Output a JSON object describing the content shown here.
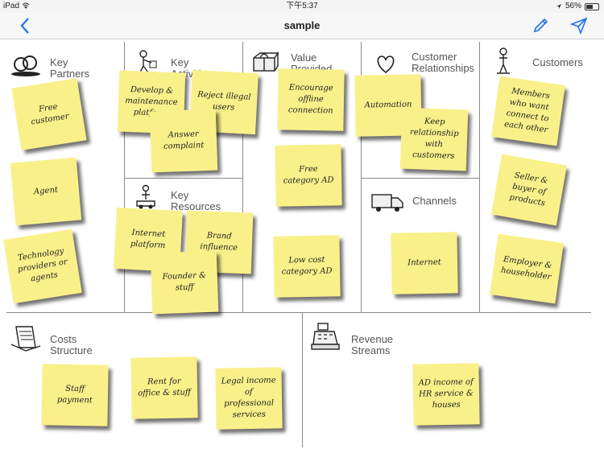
{
  "status_bar": {
    "device": "iPad",
    "time": "下午5:37",
    "battery": "56%",
    "battery_level": 0.56
  },
  "nav": {
    "title": "sample",
    "back_icon": "chevron-left-icon",
    "edit_icon": "pencil-icon",
    "send_icon": "paper-plane-icon",
    "accent": "#1a73e8"
  },
  "sections": {
    "key_partners": {
      "title": "Key Partners",
      "icon": "rings-icon"
    },
    "key_activities": {
      "title": "Key Activities",
      "icon": "worker-icon"
    },
    "value_propositions": {
      "title": "Value Provided",
      "icon": "gift-icon"
    },
    "customer_relationships": {
      "title": "Customer Relationships",
      "icon": "heart-icon"
    },
    "customers": {
      "title": "Customers",
      "icon": "person-icon"
    },
    "key_resources": {
      "title": "Key Resources",
      "icon": "forklift-icon"
    },
    "channels": {
      "title": "Channels",
      "icon": "truck-icon"
    },
    "costs": {
      "title": "Costs Structure",
      "icon": "receipt-icon"
    },
    "revenue": {
      "title": "Revenue Streams",
      "icon": "cash-register-icon"
    }
  },
  "notes": {
    "free_customer": "Free customer",
    "agent": "Agent",
    "tech_providers": "Technology providers or agents",
    "develop": "Develop & maintenance platform",
    "reject": "Reject illegal users",
    "answer": "Answer complaint",
    "internet_platform": "Internet platform",
    "brand": "Brand influence",
    "founder": "Founder & stuff",
    "encourage": "Encourage offline connection",
    "free_category": "Free category AD",
    "low_cost": "Low cost category AD",
    "automation": "Automation",
    "keep_relationship": "Keep relationship with customers",
    "internet": "Internet",
    "members": "Members who want connect to each other",
    "seller": "Seller & buyer of products",
    "employer": "Employer & householder",
    "staff_payment": "Staff payment",
    "rent": "Rent for office & stuff",
    "legal": "Legal income of professional services",
    "ad_income": "AD income of HR service & houses"
  }
}
